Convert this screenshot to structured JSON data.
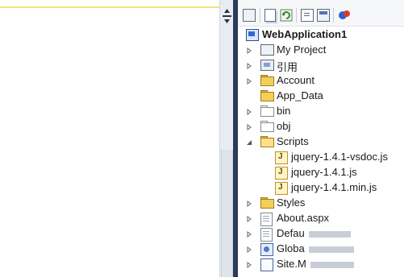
{
  "explorer": {
    "toolbar": {
      "buttons": [
        "properties-icon",
        "show-all-files-icon",
        "refresh-icon",
        "view-code-icon",
        "view-designer-icon",
        "copy-website-icon"
      ]
    },
    "tree": {
      "root_label": "WebApplication1",
      "items": [
        {
          "label": "My Project",
          "icon": "my-project-icon"
        },
        {
          "label": "引用",
          "icon": "references-icon"
        },
        {
          "label": "Account",
          "icon": "folder-icon"
        },
        {
          "label": "App_Data",
          "icon": "app-data-folder-icon"
        },
        {
          "label": "bin",
          "icon": "folder-hidden-icon"
        },
        {
          "label": "obj",
          "icon": "folder-hidden-icon"
        },
        {
          "label": "Scripts",
          "icon": "folder-open-icon"
        },
        {
          "label": "jquery-1.4.1-vsdoc.js",
          "icon": "js-file-icon"
        },
        {
          "label": "jquery-1.4.1.js",
          "icon": "js-file-icon"
        },
        {
          "label": "jquery-1.4.1.min.js",
          "icon": "js-file-icon"
        },
        {
          "label": "Styles",
          "icon": "folder-icon"
        },
        {
          "label": "About.aspx",
          "icon": "aspx-file-icon"
        },
        {
          "label": "Defau",
          "icon": "aspx-file-icon"
        },
        {
          "label": "Globa",
          "icon": "global-asax-icon"
        },
        {
          "label": "Site.M",
          "icon": "master-file-icon"
        }
      ]
    }
  },
  "colors": {
    "divider": "#2a3b58",
    "folder": "#f2cf5a",
    "toolbar_bg": "#f6f7f9",
    "editor_highlight": "#f2e27a"
  }
}
